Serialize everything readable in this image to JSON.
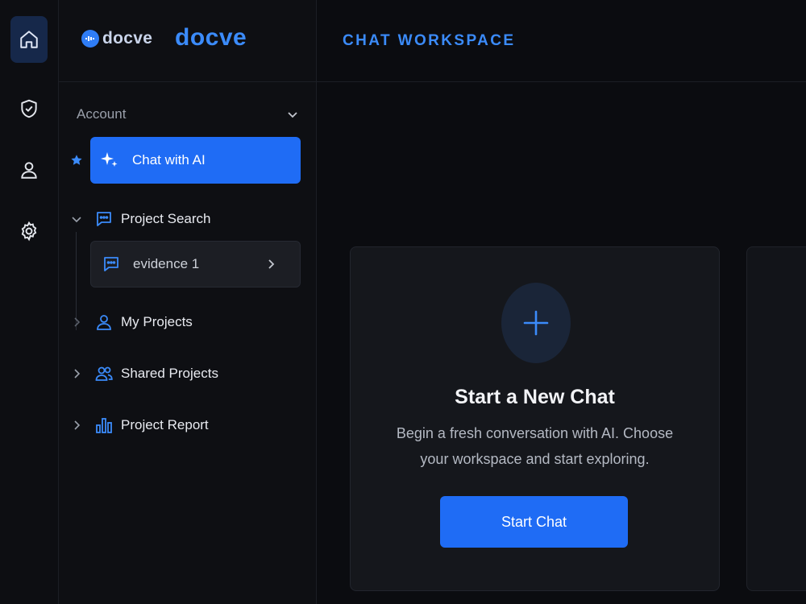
{
  "rail": {
    "items": [
      {
        "icon": "home-icon",
        "active": true
      },
      {
        "icon": "shield-icon",
        "active": false
      },
      {
        "icon": "user-icon",
        "active": false
      },
      {
        "icon": "gear-icon",
        "active": false
      }
    ]
  },
  "brand": {
    "logo_small": "docve",
    "logo_big": "docve"
  },
  "sidebar": {
    "section_label": "Account",
    "active_item": "Chat with AI",
    "items": [
      {
        "label": "Project Search",
        "expanded": true
      },
      {
        "label": "My Projects",
        "expanded": false
      },
      {
        "label": "Shared Projects",
        "expanded": false
      },
      {
        "label": "Project Report",
        "expanded": false
      }
    ],
    "sub_item": "evidence 1"
  },
  "header": {
    "title": "CHAT WORKSPACE"
  },
  "card": {
    "title": "Start a New Chat",
    "description": "Begin a fresh conversation with AI. Choose your workspace and start exploring.",
    "button_label": "Start Chat"
  },
  "colors": {
    "accent": "#1f6cf5",
    "brand": "#3b8bfa",
    "background": "#0b0c10"
  }
}
